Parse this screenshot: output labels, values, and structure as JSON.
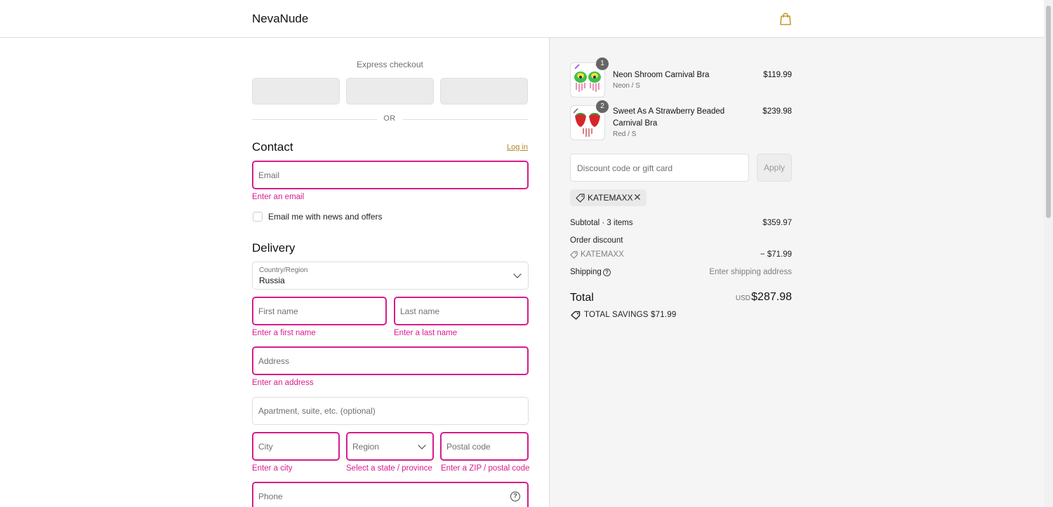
{
  "header": {
    "brand": "NevaNude"
  },
  "express": {
    "label": "Express checkout",
    "or": "OR"
  },
  "contact": {
    "title": "Contact",
    "login": "Log in",
    "email_placeholder": "Email",
    "email_error": "Enter an email",
    "newsletter_label": "Email me with news and offers"
  },
  "delivery": {
    "title": "Delivery",
    "country_label": "Country/Region",
    "country_value": "Russia",
    "first_name_placeholder": "First name",
    "first_name_error": "Enter a first name",
    "last_name_placeholder": "Last name",
    "last_name_error": "Enter a last name",
    "address_placeholder": "Address",
    "address_error": "Enter an address",
    "apartment_placeholder": "Apartment, suite, etc. (optional)",
    "city_placeholder": "City",
    "city_error": "Enter a city",
    "region_placeholder": "Region",
    "region_error": "Select a state / province",
    "postal_placeholder": "Postal code",
    "postal_error": "Enter a ZIP / postal code",
    "phone_placeholder": "Phone"
  },
  "order": {
    "items": [
      {
        "qty": "1",
        "name": "Neon Shroom Carnival Bra",
        "variant": "Neon / S",
        "price": "$119.99"
      },
      {
        "qty": "2",
        "name": "Sweet As A Strawberry Beaded Carnival Bra",
        "variant": "Red / S",
        "price": "$239.98"
      }
    ],
    "discount_placeholder": "Discount code or gift card",
    "apply_label": "Apply",
    "applied_code": "KATEMAXX",
    "subtotal_label": "Subtotal · 3 items",
    "subtotal_value": "$359.97",
    "order_discount_label": "Order discount",
    "discount_code": "KATEMAXX",
    "discount_value": "− $71.99",
    "shipping_label": "Shipping",
    "shipping_value": "Enter shipping address",
    "total_label": "Total",
    "currency": "USD",
    "total_value": "$287.98",
    "savings": "TOTAL SAVINGS  $71.99"
  },
  "colors": {
    "error": "#d81b8c",
    "link": "#b08a2e",
    "panel_bg": "#f5f5f5"
  }
}
